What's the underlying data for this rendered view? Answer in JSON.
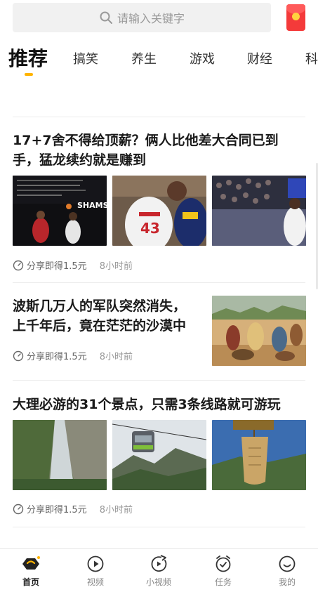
{
  "search": {
    "placeholder": "请输入关键字"
  },
  "tabs": [
    {
      "label": "推荐",
      "active": true
    },
    {
      "label": "搞笑"
    },
    {
      "label": "养生"
    },
    {
      "label": "游戏"
    },
    {
      "label": "财经"
    },
    {
      "label": "科"
    }
  ],
  "articles": [
    {
      "title_line1": "17+7舍不得给顶薪？俩人比他差大合同已到",
      "title_line2": "手，猛龙续约就是赚到",
      "thumb_text": "SHAMS",
      "meta_share": "分享即得1.5元",
      "meta_time": "8小时前"
    },
    {
      "title_line1": "波斯几万人的军队突然消失，",
      "title_line2": "上千年后，竟在茫茫的沙漠中",
      "meta_share": "分享即得1.5元",
      "meta_time": "8小时前"
    },
    {
      "title_line1": "大理必游的31个景点，只需3条线路就可游玩",
      "meta_share": "分享即得1.5元",
      "meta_time": "8小时前"
    }
  ],
  "bottom_nav": [
    {
      "label": "首页",
      "icon": "home-hexagon-icon",
      "active": true
    },
    {
      "label": "视频",
      "icon": "video-play-icon"
    },
    {
      "label": "小视频",
      "icon": "short-video-icon"
    },
    {
      "label": "任务",
      "icon": "task-alarm-icon"
    },
    {
      "label": "我的",
      "icon": "profile-smile-icon"
    }
  ],
  "colors": {
    "accent": "#ffb400",
    "redpacket": "#f43a3a"
  }
}
